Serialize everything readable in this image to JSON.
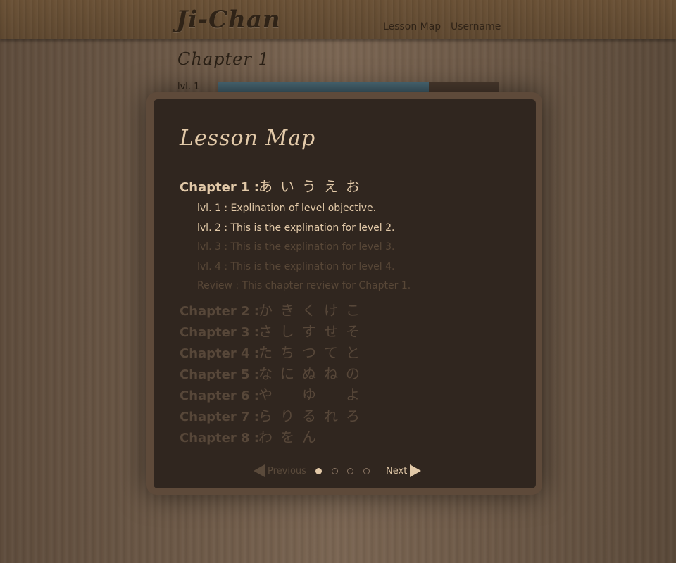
{
  "header": {
    "logo": "Ji-Chan",
    "nav": {
      "lesson_map": "Lesson Map",
      "username": "Username"
    }
  },
  "page": {
    "title": "Chapter 1",
    "level_label": "lvl. 1",
    "progress_fraction": 0.75
  },
  "modal": {
    "title": "Lesson Map",
    "chapter1": {
      "label": "Chapter 1 :",
      "kana": [
        "あ",
        "い",
        "う",
        "え",
        "お"
      ],
      "levels": [
        {
          "text": "lvl. 1 : Explination of level objective.",
          "locked": false
        },
        {
          "text": "lvl. 2 : This is the explination for level 2.",
          "locked": false
        },
        {
          "text": "lvl. 3 : This is the explination for level 3.",
          "locked": true
        },
        {
          "text": "lvl. 4 : This is the explination for level 4.",
          "locked": true
        },
        {
          "text": "Review : This chapter review for Chapter 1.",
          "locked": true
        }
      ]
    },
    "other_chapters": [
      {
        "label": "Chapter 2 :",
        "kana": [
          "か",
          "き",
          "く",
          "け",
          "こ"
        ]
      },
      {
        "label": "Chapter 3 :",
        "kana": [
          "さ",
          "し",
          "す",
          "せ",
          "そ"
        ]
      },
      {
        "label": "Chapter 4 :",
        "kana": [
          "た",
          "ち",
          "つ",
          "て",
          "と"
        ]
      },
      {
        "label": "Chapter 5 :",
        "kana": [
          "な",
          "に",
          "ぬ",
          "ね",
          "の"
        ]
      },
      {
        "label": "Chapter 6 :",
        "kana": [
          "や",
          "",
          "ゆ",
          "",
          "よ"
        ]
      },
      {
        "label": "Chapter 7 :",
        "kana": [
          "ら",
          "り",
          "る",
          "れ",
          "ろ"
        ]
      },
      {
        "label": "Chapter 8 :",
        "kana": [
          "わ",
          "を",
          "ん"
        ]
      }
    ],
    "pager": {
      "previous": "Previous",
      "next": "Next",
      "pages": 4,
      "current": 1
    }
  },
  "colors": {
    "accent_text": "#e2c9a8",
    "dim_text": "#574739",
    "panel_bg": "#30261f",
    "progress_fill": "#4d6d7a"
  }
}
